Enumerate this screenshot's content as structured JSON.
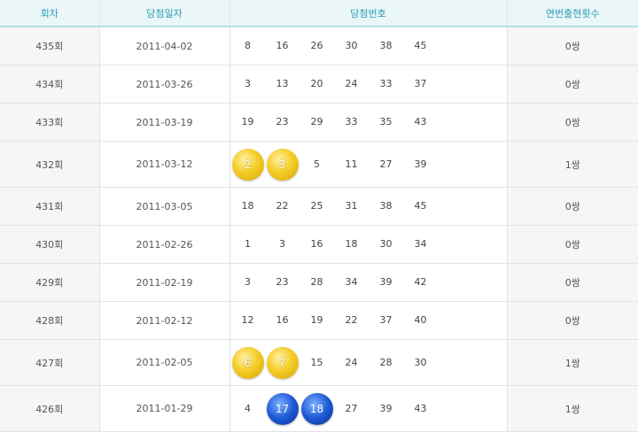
{
  "headers": {
    "round": "회차",
    "date": "당첨일자",
    "numbers": "당첨번호",
    "consecutive": "연번출현횟수"
  },
  "ball_colors": {
    "yellow": "#f5cd28",
    "blue": "#1d5ad6"
  },
  "rows": [
    {
      "round": "435회",
      "date": "2011-04-02",
      "nums": [
        "8",
        "16",
        "26",
        "30",
        "38",
        "45"
      ],
      "balls": [
        "",
        "",
        "",
        "",
        "",
        ""
      ],
      "count": "0쌍"
    },
    {
      "round": "434회",
      "date": "2011-03-26",
      "nums": [
        "3",
        "13",
        "20",
        "24",
        "33",
        "37"
      ],
      "balls": [
        "",
        "",
        "",
        "",
        "",
        ""
      ],
      "count": "0쌍"
    },
    {
      "round": "433회",
      "date": "2011-03-19",
      "nums": [
        "19",
        "23",
        "29",
        "33",
        "35",
        "43"
      ],
      "balls": [
        "",
        "",
        "",
        "",
        "",
        ""
      ],
      "count": "0쌍"
    },
    {
      "round": "432회",
      "date": "2011-03-12",
      "nums": [
        "2",
        "3",
        "5",
        "11",
        "27",
        "39"
      ],
      "balls": [
        "yellow",
        "yellow",
        "",
        "",
        "",
        ""
      ],
      "count": "1쌍"
    },
    {
      "round": "431회",
      "date": "2011-03-05",
      "nums": [
        "18",
        "22",
        "25",
        "31",
        "38",
        "45"
      ],
      "balls": [
        "",
        "",
        "",
        "",
        "",
        ""
      ],
      "count": "0쌍"
    },
    {
      "round": "430회",
      "date": "2011-02-26",
      "nums": [
        "1",
        "3",
        "16",
        "18",
        "30",
        "34"
      ],
      "balls": [
        "",
        "",
        "",
        "",
        "",
        ""
      ],
      "count": "0쌍"
    },
    {
      "round": "429회",
      "date": "2011-02-19",
      "nums": [
        "3",
        "23",
        "28",
        "34",
        "39",
        "42"
      ],
      "balls": [
        "",
        "",
        "",
        "",
        "",
        ""
      ],
      "count": "0쌍"
    },
    {
      "round": "428회",
      "date": "2011-02-12",
      "nums": [
        "12",
        "16",
        "19",
        "22",
        "37",
        "40"
      ],
      "balls": [
        "",
        "",
        "",
        "",
        "",
        ""
      ],
      "count": "0쌍"
    },
    {
      "round": "427회",
      "date": "2011-02-05",
      "nums": [
        "6",
        "7",
        "15",
        "24",
        "28",
        "30"
      ],
      "balls": [
        "yellow",
        "yellow",
        "",
        "",
        "",
        ""
      ],
      "count": "1쌍"
    },
    {
      "round": "426회",
      "date": "2011-01-29",
      "nums": [
        "4",
        "17",
        "18",
        "27",
        "39",
        "43"
      ],
      "balls": [
        "",
        "blue",
        "blue",
        "",
        "",
        ""
      ],
      "count": "1쌍"
    }
  ]
}
